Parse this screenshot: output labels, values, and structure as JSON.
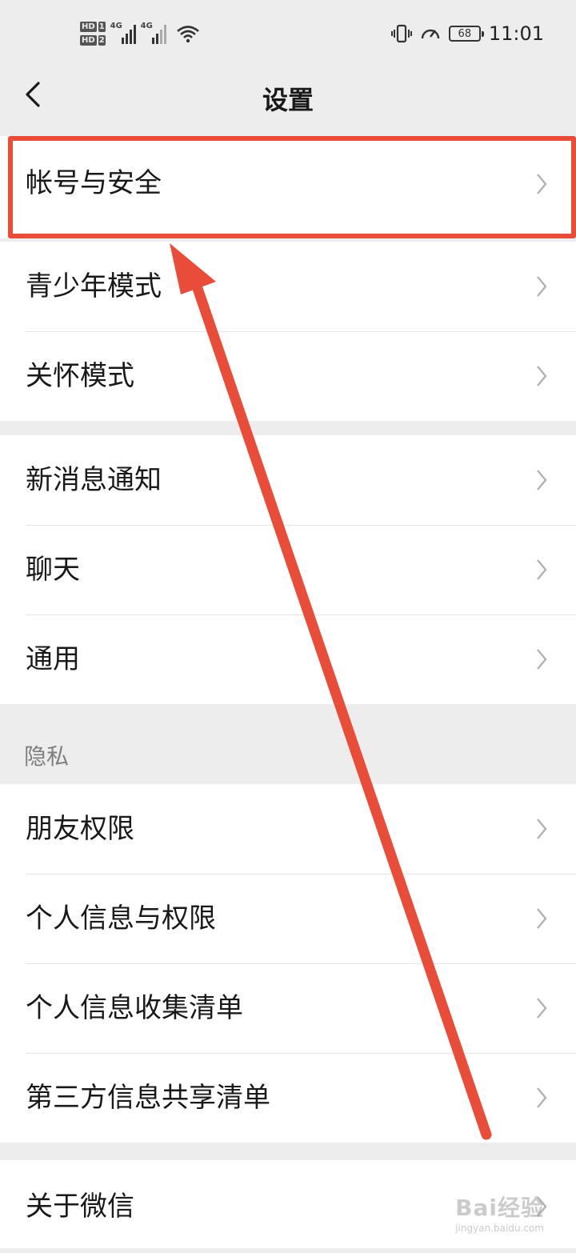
{
  "status_bar": {
    "sim1_tag": "HD",
    "sim1_num": "1",
    "sim2_tag": "HD",
    "sim2_num": "2",
    "network1": "4G",
    "network2": "4G",
    "battery_level": "68",
    "time": "11:01",
    "icons": [
      "signal-icon",
      "wifi-icon",
      "vibrate-icon",
      "speed-icon",
      "battery-icon"
    ]
  },
  "nav": {
    "title": "设置",
    "back_icon": "chevron-left-icon"
  },
  "groups": [
    {
      "items": [
        {
          "label": "帐号与安全"
        }
      ]
    },
    {
      "items": [
        {
          "label": "青少年模式"
        },
        {
          "label": "关怀模式"
        }
      ]
    },
    {
      "items": [
        {
          "label": "新消息通知"
        },
        {
          "label": "聊天"
        },
        {
          "label": "通用"
        }
      ]
    },
    {
      "header": "隐私",
      "items": [
        {
          "label": "朋友权限"
        },
        {
          "label": "个人信息与权限"
        },
        {
          "label": "个人信息收集清单"
        },
        {
          "label": "第三方信息共享清单"
        }
      ]
    },
    {
      "items": [
        {
          "label": "关于微信"
        }
      ]
    }
  ],
  "annotation": {
    "color": "#ea4c3a"
  },
  "watermark": {
    "line1": "Bai经验",
    "line2": "jingyan.baidu.com"
  },
  "colors": {
    "background": "#ededed",
    "cell": "#ffffff",
    "text": "#191919",
    "chevron": "#b2b2b2"
  }
}
